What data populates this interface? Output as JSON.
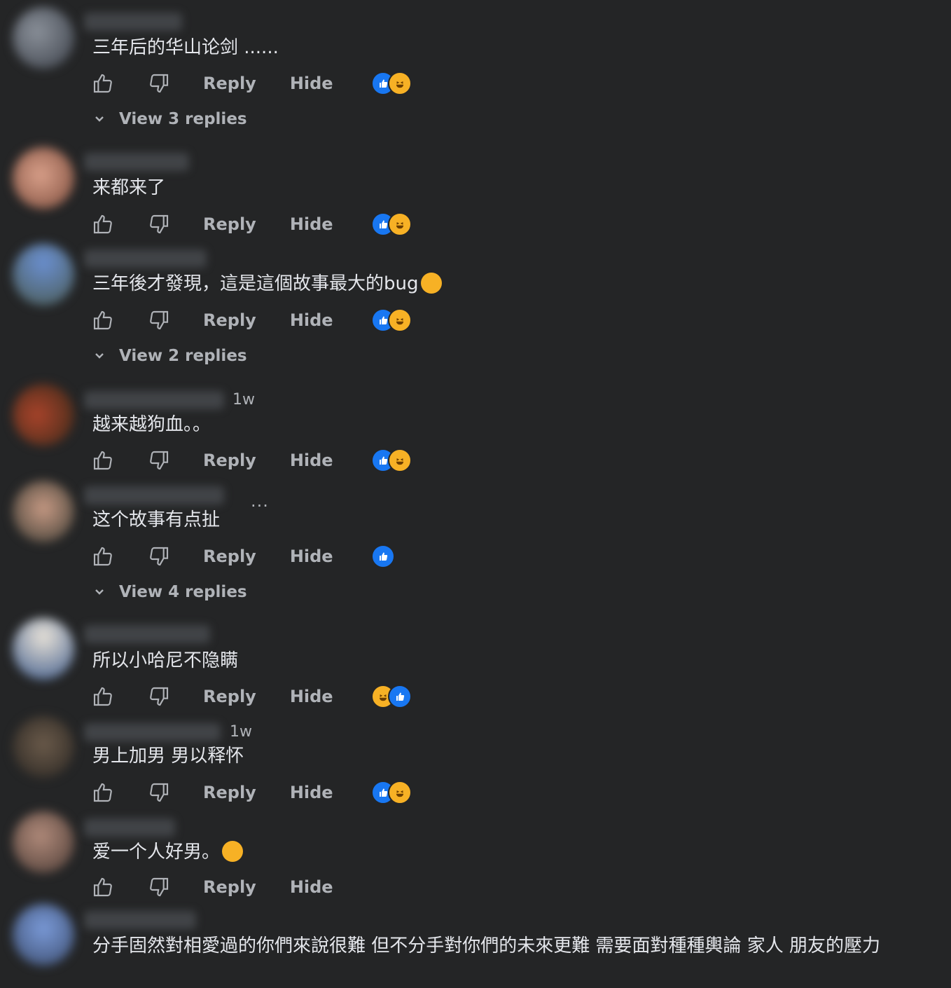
{
  "labels": {
    "reply": "Reply",
    "hide": "Hide"
  },
  "comments": [
    {
      "time": "",
      "text": "三年后的华山论剑 ......",
      "reactions": [
        "like",
        "haha"
      ],
      "view_replies": "View 3 replies"
    },
    {
      "time": "",
      "text": "来都来了",
      "reactions": [
        "like",
        "haha"
      ],
      "view_replies": ""
    },
    {
      "time": "",
      "text": "三年後才發現，這是這個故事最大的bug",
      "reactions": [
        "like",
        "haha"
      ],
      "view_replies": "View 2 replies",
      "trailing_emoji": "laughing-tears"
    },
    {
      "time": "1w",
      "text": "越来越狗血。。",
      "reactions": [
        "like",
        "haha"
      ],
      "view_replies": ""
    },
    {
      "time": "",
      "text": "这个故事有点扯",
      "reactions": [
        "like"
      ],
      "view_replies": "View 4 replies",
      "more": "···"
    },
    {
      "time": "",
      "text": "所以小哈尼不隐瞒",
      "reactions": [
        "haha",
        "like"
      ],
      "view_replies": ""
    },
    {
      "time": "1w",
      "text": "男上加男 男以释怀",
      "reactions": [
        "like",
        "haha"
      ],
      "view_replies": ""
    },
    {
      "time": "",
      "text": "爱一个人好男。",
      "reactions": [],
      "view_replies": "",
      "trailing_emoji": "sweat-smile"
    },
    {
      "time": "",
      "text": "分手固然對相愛過的你們來說很難 但不分手對你們的未來更難 需要面對種種輿論 家人 朋友的壓力",
      "reactions": [],
      "view_replies": ""
    }
  ],
  "colors": {
    "background": "#242526",
    "text": "#e4e6eb",
    "muted": "#b0b3b8",
    "like": "#1877f2",
    "haha": "#f7b125"
  }
}
